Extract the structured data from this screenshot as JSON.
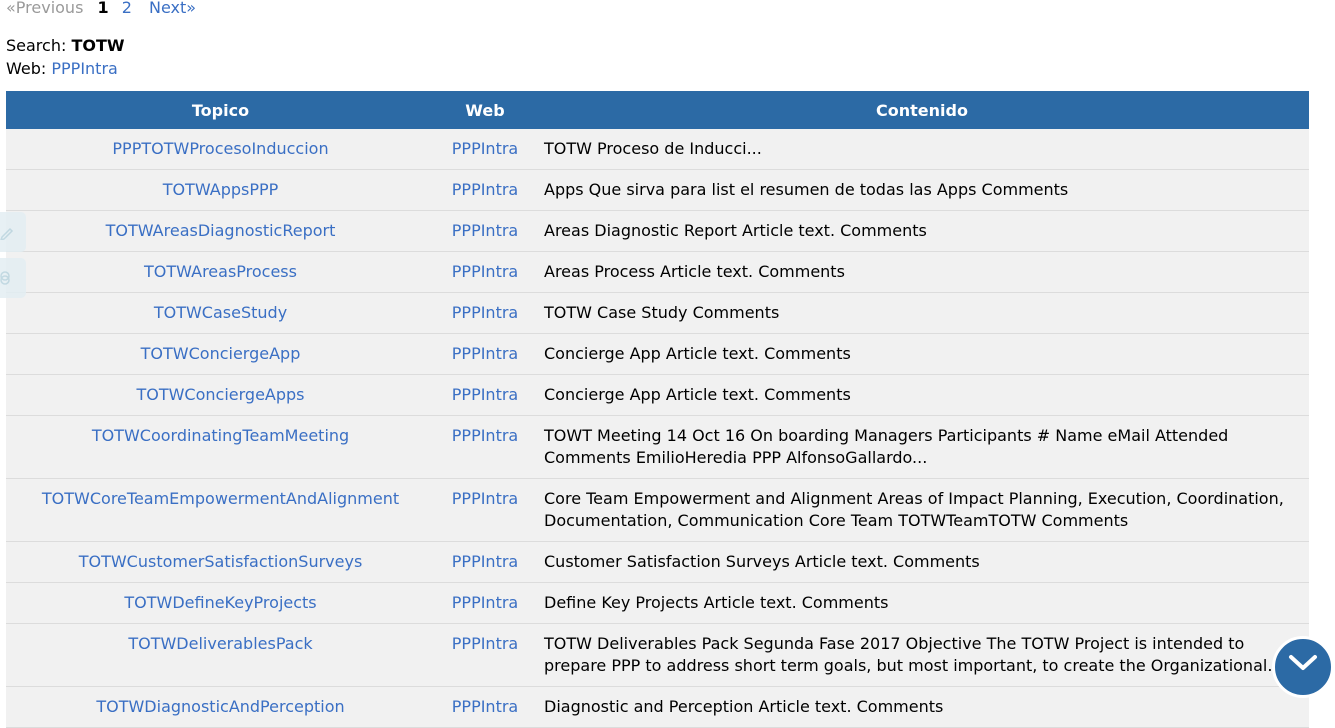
{
  "pager": {
    "prev_label": "«Previous",
    "current_page": "1",
    "page_2": "2",
    "next_label": "Next»"
  },
  "search": {
    "label": "Search:",
    "term": "TOTW"
  },
  "web_filter": {
    "label": "Web:",
    "value": "PPPIntra"
  },
  "table": {
    "headers": {
      "topic": "Topico",
      "web": "Web",
      "content": "Contenido"
    },
    "rows": [
      {
        "topic": "PPPTOTWProcesoInduccion",
        "web": "PPPIntra",
        "content": "TOTW Proceso de Inducci..."
      },
      {
        "topic": "TOTWAppsPPP",
        "web": "PPPIntra",
        "content": "Apps Que sirva para list el resumen de todas las Apps Comments"
      },
      {
        "topic": "TOTWAreasDiagnosticReport",
        "web": "PPPIntra",
        "content": "Areas Diagnostic Report Article text. Comments"
      },
      {
        "topic": "TOTWAreasProcess",
        "web": "PPPIntra",
        "content": "Areas Process Article text. Comments"
      },
      {
        "topic": "TOTWCaseStudy",
        "web": "PPPIntra",
        "content": "TOTW Case Study Comments"
      },
      {
        "topic": "TOTWConciergeApp",
        "web": "PPPIntra",
        "content": "Concierge App Article text. Comments"
      },
      {
        "topic": "TOTWConciergeApps",
        "web": "PPPIntra",
        "content": "Concierge App Article text. Comments"
      },
      {
        "topic": "TOTWCoordinatingTeamMeeting",
        "web": "PPPIntra",
        "content": "TOWT Meeting 14 Oct 16 On boarding Managers Participants # Name eMail Attended Comments EmilioHeredia PPP AlfonsoGallardo..."
      },
      {
        "topic": "TOTWCoreTeamEmpowermentAndAlignment",
        "web": "PPPIntra",
        "content": "Core Team Empowerment and Alignment Areas of Impact Planning, Execution, Coordination, Documentation, Communication Core Team TOTWTeamTOTW Comments"
      },
      {
        "topic": "TOTWCustomerSatisfactionSurveys",
        "web": "PPPIntra",
        "content": "Customer Satisfaction Surveys Article text. Comments"
      },
      {
        "topic": "TOTWDefineKeyProjects",
        "web": "PPPIntra",
        "content": "Define Key Projects Article text. Comments"
      },
      {
        "topic": "TOTWDeliverablesPack",
        "web": "PPPIntra",
        "content": "TOTW Deliverables Pack Segunda Fase 2017 Objective The TOTW Project is intended to prepare PPP to address short term goals, but most important, to create the Organizational..."
      },
      {
        "topic": "TOTWDiagnosticAndPerception",
        "web": "PPPIntra",
        "content": "Diagnostic and Perception Article text. Comments"
      }
    ]
  },
  "icons": {
    "side_tab_1": "pencil-icon",
    "side_tab_2": "link-icon",
    "scroll_button": "chevron-down-icon"
  },
  "colors": {
    "header_bg": "#2c6aa5",
    "link": "#3a6fc4",
    "row_bg": "#f1f1f1"
  }
}
